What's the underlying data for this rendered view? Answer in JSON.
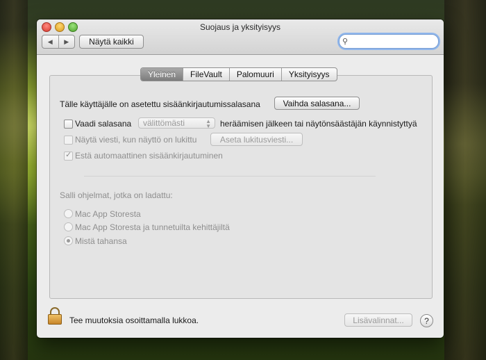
{
  "window": {
    "title": "Suojaus ja yksityisyys",
    "show_all_label": "Näytä kaikki",
    "search": {
      "value": "",
      "placeholder": ""
    }
  },
  "tabs": [
    {
      "label": "Yleinen",
      "active": true
    },
    {
      "label": "FileVault",
      "active": false
    },
    {
      "label": "Palomuuri",
      "active": false
    },
    {
      "label": "Yksityisyys",
      "active": false
    }
  ],
  "general": {
    "password_text": "Tälle käyttäjälle on asetettu sisäänkirjautumissalasana",
    "change_password_label": "Vaihda salasana...",
    "require_password_label": "Vaadi salasana",
    "require_password_checked": false,
    "delay_value": "välittömästi",
    "after_sleep_text": "heräämisen jälkeen tai näytönsäästäjän käynnistyttyä",
    "show_message_label": "Näytä viesti, kun näyttö on lukittu",
    "show_message_checked": false,
    "set_message_label": "Aseta lukitusviesti...",
    "disable_autologin_label": "Estä automaattinen sisäänkirjautuminen",
    "disable_autologin_checked": true,
    "allow_apps_heading": "Salli ohjelmat, jotka on ladattu:",
    "app_sources": [
      {
        "label": "Mac App Storesta",
        "selected": false
      },
      {
        "label": "Mac App Storesta ja tunnetuilta kehittäjiltä",
        "selected": false
      },
      {
        "label": "Mistä tahansa",
        "selected": true
      }
    ]
  },
  "footer": {
    "lock_text": "Tee muutoksia osoittamalla lukkoa.",
    "advanced_label": "Lisävalinnat...",
    "help_label": "?"
  },
  "icons": {
    "back": "◀",
    "forward": "▶",
    "search": "⚲",
    "check": "✓"
  },
  "colors": {
    "window_bg": "#ececec",
    "active_tab": "#8a8a8a",
    "search_focus": "#8fb6ec"
  }
}
